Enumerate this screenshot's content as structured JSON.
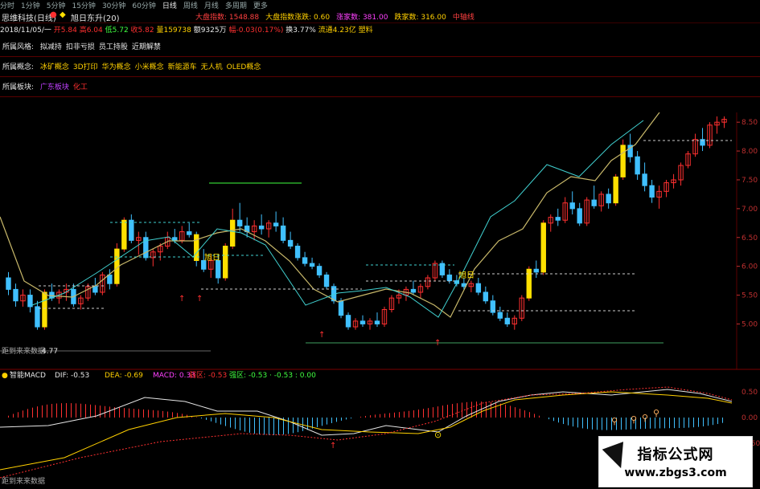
{
  "periods": [
    "分时",
    "1分钟",
    "5分钟",
    "15分钟",
    "30分钟",
    "60分钟",
    "日线",
    "周线",
    "月线",
    "多周期",
    "更多"
  ],
  "active_period": "日线",
  "header": {
    "stock": "思维科技(日线)",
    "indicator": "旭日东升(20)",
    "market_labels": [
      {
        "text": "大盘指数: 1548.88",
        "color": "#ff4040"
      },
      {
        "text": "大盘指数涨跌: 0.60",
        "color": "#ffd000"
      },
      {
        "text": "涨家数: 381.00",
        "color": "#ff40ff"
      },
      {
        "text": "跌家数: 316.00",
        "color": "#ffd000"
      },
      {
        "text": "中轴线",
        "color": "#ff4040"
      }
    ]
  },
  "quote": {
    "date": "2018/11/05/一",
    "open": "开5.84",
    "high": "高6.04",
    "low": "低5.72",
    "close": "收5.82",
    "volume": "量159738",
    "amount": "额9325万",
    "change": "幅-0.03(0.17%)",
    "turnover": "换3.77%",
    "float_cap": "流通4.23亿",
    "sector": "塑料"
  },
  "rows": [
    {
      "label": "所属风格:",
      "tags": [
        {
          "text": "拟减持",
          "color": "#e6e6e6"
        },
        {
          "text": "扣非亏损",
          "color": "#e6e6e6"
        },
        {
          "text": "员工持股",
          "color": "#e6e6e6"
        },
        {
          "text": "近期解禁",
          "color": "#e6e6e6"
        }
      ]
    },
    {
      "label": "所属概念:",
      "tags": [
        {
          "text": "冰矿概念",
          "color": "#ffd000"
        },
        {
          "text": "3D打印",
          "color": "#ffd000"
        },
        {
          "text": "华为概念",
          "color": "#ffd000"
        },
        {
          "text": "小米概念",
          "color": "#ffd000"
        },
        {
          "text": "新能源车",
          "color": "#ffd000"
        },
        {
          "text": "无人机",
          "color": "#ffd000"
        },
        {
          "text": "OLED概念",
          "color": "#ffd000"
        }
      ]
    },
    {
      "label": "所属板块:",
      "tags": [
        {
          "text": "广东板块",
          "color": "#c040ff"
        },
        {
          "text": "化工",
          "color": "#ff3030"
        }
      ]
    }
  ],
  "price_axis": [
    "8.50",
    "8.00",
    "7.50",
    "7.00",
    "6.50",
    "6.00",
    "5.50",
    "5.00"
  ],
  "macd_axis": [
    "0.50",
    "0.00",
    "-0.50"
  ],
  "chart_text": {
    "low_marker": "距到来来数据",
    "low_value": "4.77",
    "label_xuri1": "旭日",
    "label_xuri2": "旭日"
  },
  "macd": {
    "name": "智能MACD",
    "dif": "DIF: -0.53",
    "dea": "DEA: -0.69",
    "macd": "MACD: 0.33",
    "extra1": "弱区: -0.53",
    "extra2": "强区: -0.53 · -0.53 : 0.00",
    "bottom_label": "距到来来数据"
  },
  "watermark": {
    "title": "指标公式网",
    "url": "www.zbgs3.com"
  },
  "colors": {
    "up": "#ff3030",
    "down": "#40c0ff",
    "signal": "#ffe000",
    "ma": "#c8b86a"
  },
  "chart_data": {
    "type": "candlestick",
    "ylim": [
      4.7,
      8.6
    ],
    "candles": [
      [
        5.8,
        5.9,
        5.5,
        5.6
      ],
      [
        5.6,
        5.7,
        5.3,
        5.4
      ],
      [
        5.4,
        5.6,
        5.3,
        5.5
      ],
      [
        5.5,
        5.6,
        5.2,
        5.3
      ],
      [
        5.3,
        5.4,
        4.9,
        4.95
      ],
      [
        4.95,
        5.6,
        4.9,
        5.55
      ],
      [
        5.55,
        5.7,
        5.4,
        5.45
      ],
      [
        5.45,
        5.6,
        5.35,
        5.55
      ],
      [
        5.55,
        5.7,
        5.4,
        5.6
      ],
      [
        5.6,
        5.7,
        5.3,
        5.35
      ],
      [
        5.35,
        5.5,
        5.25,
        5.45
      ],
      [
        5.45,
        5.7,
        5.4,
        5.65
      ],
      [
        5.65,
        5.8,
        5.5,
        5.55
      ],
      [
        5.55,
        5.9,
        5.5,
        5.85
      ],
      [
        5.85,
        5.95,
        5.6,
        5.7
      ],
      [
        5.7,
        6.4,
        5.65,
        6.3
      ],
      [
        6.3,
        6.85,
        6.25,
        6.8
      ],
      [
        6.8,
        6.9,
        6.4,
        6.45
      ],
      [
        6.45,
        6.6,
        6.2,
        6.5
      ],
      [
        6.5,
        6.6,
        6.1,
        6.15
      ],
      [
        6.15,
        6.3,
        6.0,
        6.25
      ],
      [
        6.25,
        6.4,
        6.1,
        6.35
      ],
      [
        6.35,
        6.6,
        6.3,
        6.5
      ],
      [
        6.5,
        6.65,
        6.4,
        6.45
      ],
      [
        6.45,
        6.7,
        6.4,
        6.6
      ],
      [
        6.6,
        6.75,
        6.5,
        6.55
      ],
      [
        6.55,
        6.6,
        6.0,
        6.1
      ],
      [
        6.1,
        6.3,
        5.9,
        5.95
      ],
      [
        5.95,
        6.2,
        5.8,
        6.1
      ],
      [
        6.1,
        6.2,
        5.7,
        5.8
      ],
      [
        5.8,
        6.4,
        5.75,
        6.35
      ],
      [
        6.35,
        7.0,
        6.3,
        6.8
      ],
      [
        6.8,
        7.1,
        6.6,
        6.7
      ],
      [
        6.7,
        6.85,
        6.5,
        6.6
      ],
      [
        6.6,
        6.8,
        6.45,
        6.7
      ],
      [
        6.7,
        6.9,
        6.55,
        6.65
      ],
      [
        6.65,
        6.8,
        6.5,
        6.75
      ],
      [
        6.75,
        6.95,
        6.6,
        6.7
      ],
      [
        6.7,
        6.85,
        6.4,
        6.45
      ],
      [
        6.45,
        6.6,
        6.3,
        6.35
      ],
      [
        6.35,
        6.4,
        6.1,
        6.15
      ],
      [
        6.15,
        6.25,
        6.0,
        6.05
      ],
      [
        6.05,
        6.15,
        5.95,
        6.0
      ],
      [
        6.0,
        6.05,
        5.8,
        5.85
      ],
      [
        5.85,
        5.9,
        5.6,
        5.65
      ],
      [
        5.65,
        5.7,
        5.35,
        5.4
      ],
      [
        5.4,
        5.45,
        5.1,
        5.15
      ],
      [
        5.15,
        5.2,
        4.9,
        4.95
      ],
      [
        4.95,
        5.1,
        4.9,
        5.05
      ],
      [
        5.05,
        5.15,
        4.95,
        5.0
      ],
      [
        5.0,
        5.1,
        4.9,
        5.05
      ],
      [
        5.05,
        5.2,
        4.95,
        5.0
      ],
      [
        5.0,
        5.3,
        4.95,
        5.25
      ],
      [
        5.25,
        5.5,
        5.2,
        5.45
      ],
      [
        5.45,
        5.6,
        5.35,
        5.5
      ],
      [
        5.5,
        5.65,
        5.4,
        5.6
      ],
      [
        5.6,
        5.75,
        5.5,
        5.55
      ],
      [
        5.55,
        5.7,
        5.45,
        5.65
      ],
      [
        5.65,
        5.85,
        5.6,
        5.8
      ],
      [
        5.8,
        6.1,
        5.75,
        6.05
      ],
      [
        6.05,
        6.1,
        5.8,
        5.85
      ],
      [
        5.85,
        5.95,
        5.7,
        5.75
      ],
      [
        5.75,
        5.85,
        5.65,
        5.7
      ],
      [
        5.7,
        5.8,
        5.6,
        5.65
      ],
      [
        5.65,
        5.75,
        5.55,
        5.7
      ],
      [
        5.7,
        5.8,
        5.5,
        5.55
      ],
      [
        5.55,
        5.65,
        5.35,
        5.4
      ],
      [
        5.4,
        5.5,
        5.15,
        5.2
      ],
      [
        5.2,
        5.3,
        5.05,
        5.1
      ],
      [
        5.1,
        5.2,
        4.95,
        5.0
      ],
      [
        5.0,
        5.15,
        4.9,
        5.1
      ],
      [
        5.1,
        5.5,
        5.05,
        5.45
      ],
      [
        5.45,
        6.0,
        5.4,
        5.95
      ],
      [
        5.95,
        6.1,
        5.8,
        5.9
      ],
      [
        5.9,
        6.8,
        5.85,
        6.75
      ],
      [
        6.75,
        6.9,
        6.6,
        6.85
      ],
      [
        6.85,
        7.0,
        6.7,
        6.8
      ],
      [
        6.8,
        7.2,
        6.75,
        7.1
      ],
      [
        7.1,
        7.3,
        6.9,
        7.0
      ],
      [
        7.0,
        7.1,
        6.7,
        6.75
      ],
      [
        6.75,
        7.2,
        6.7,
        7.15
      ],
      [
        7.15,
        7.4,
        7.0,
        7.05
      ],
      [
        7.05,
        7.3,
        6.95,
        7.25
      ],
      [
        7.25,
        7.35,
        7.0,
        7.1
      ],
      [
        7.1,
        7.6,
        7.05,
        7.55
      ],
      [
        7.55,
        8.2,
        7.5,
        8.1
      ],
      [
        8.1,
        8.3,
        7.8,
        7.9
      ],
      [
        7.9,
        8.0,
        7.5,
        7.6
      ],
      [
        7.6,
        7.8,
        7.3,
        7.4
      ],
      [
        7.4,
        7.5,
        7.1,
        7.2
      ],
      [
        7.2,
        7.4,
        7.0,
        7.3
      ],
      [
        7.3,
        7.5,
        7.2,
        7.45
      ],
      [
        7.45,
        7.6,
        7.35,
        7.5
      ],
      [
        7.5,
        7.8,
        7.4,
        7.75
      ],
      [
        7.75,
        8.0,
        7.7,
        7.95
      ],
      [
        7.95,
        8.3,
        7.9,
        8.2
      ],
      [
        8.2,
        8.4,
        8.0,
        8.1
      ],
      [
        8.1,
        8.5,
        8.05,
        8.45
      ],
      [
        8.45,
        8.6,
        8.3,
        8.5
      ],
      [
        8.5,
        8.6,
        8.4,
        8.55
      ]
    ]
  }
}
